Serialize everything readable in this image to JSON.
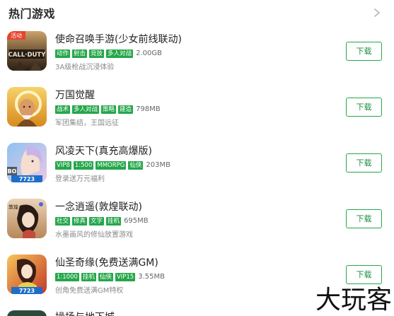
{
  "header": {
    "title": "热门游戏"
  },
  "games": [
    {
      "name": "使命召唤手游(少女前线联动)",
      "tags": [
        "动作",
        "射击",
        "竞技",
        "多人对战"
      ],
      "size": "2.00GB",
      "description": "3A级枪战沉浸体验",
      "button": "下载",
      "badge": "活动",
      "icon_text": "CALL·DUTY",
      "icon": "call-of-duty-icon"
    },
    {
      "name": "万国觉醒",
      "tags": [
        "战术",
        "多人对战",
        "策略",
        "建造"
      ],
      "size": "798MB",
      "description": "军团集结，王国远征",
      "button": "下载",
      "icon": "rise-of-kingdoms-icon"
    },
    {
      "name": "风凌天下(真充高爆版)",
      "tags": [
        "VIP8",
        "1:500",
        "MMORPG",
        "仙侠"
      ],
      "size": "203MB",
      "description": "登录送万元福利",
      "button": "下载",
      "icon_text": "7723",
      "icon_corner": "BO",
      "icon": "fengling-tianxia-icon"
    },
    {
      "name": "一念逍遥(敦煌联动)",
      "tags": [
        "社交",
        "修真",
        "文字",
        "挂机"
      ],
      "size": "695MB",
      "description": "水墨画风的修仙放置游戏",
      "button": "下载",
      "icon_text": "敦煌",
      "icon": "yinian-xiaoyao-icon"
    },
    {
      "name": "仙圣奇缘(免费送满GM)",
      "tags": [
        "1:1000",
        "挂机",
        "仙侠",
        "VIP15"
      ],
      "size": "3.55MB",
      "description": "创角免费送满GM特权",
      "button": "下载",
      "icon_text": "7723",
      "icon": "xiansheng-qiyuan-icon"
    }
  ],
  "partial_game": {
    "name": "操场与地下城"
  },
  "watermark": {
    "text": "大玩客"
  },
  "colors": {
    "accent": "#25a74a",
    "button_text": "#1a8f3c",
    "badge": "#e8432e"
  }
}
